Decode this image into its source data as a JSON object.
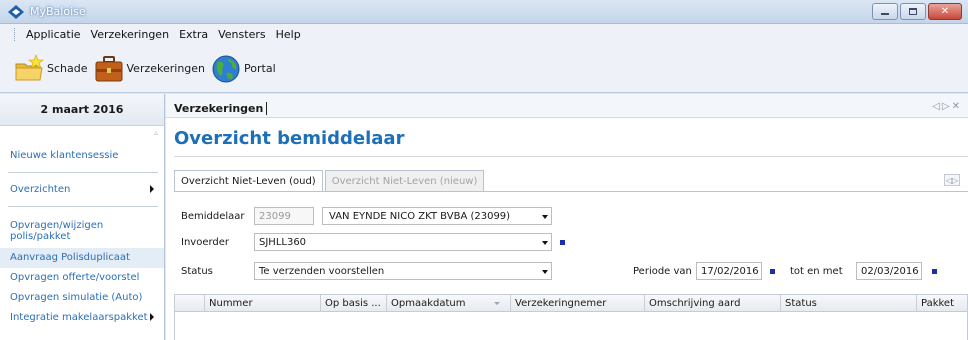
{
  "window": {
    "title": "MyBaloise"
  },
  "menu": [
    "Applicatie",
    "Verzekeringen",
    "Extra",
    "Vensters",
    "Help"
  ],
  "toolbar": [
    {
      "label": "Schade",
      "icon": "folder-star-icon"
    },
    {
      "label": "Verzekeringen",
      "icon": "briefcase-icon"
    },
    {
      "label": "Portal",
      "icon": "globe-icon"
    }
  ],
  "left_panel": {
    "date": "2 maart 2016",
    "items": {
      "new_session": "Nieuwe klantensessie",
      "overviews": "Overzichten",
      "query_change_1": "Opvragen/wijzigen",
      "query_change_2": "polis/pakket",
      "duplicate": "Aanvraag Polisduplicaat",
      "quote": "Opvragen offerte/voorstel",
      "simulation": "Opvragen simulatie (Auto)",
      "integration": "Integratie makelaarspakket"
    }
  },
  "main": {
    "tab": "Verzekeringen",
    "title": "Overzicht bemiddelaar",
    "subtabs": {
      "active": "Overzicht Niet-Leven (oud)",
      "inactive": "Overzicht Niet-Leven (nieuw)"
    },
    "form": {
      "bemiddelaar_label": "Bemiddelaar",
      "bemiddelaar_code": "23099",
      "bemiddelaar_name": "VAN EYNDE NICO ZKT BVBA (23099)",
      "invoerder_label": "Invoerder",
      "invoerder_value": "SJHLL360",
      "status_label": "Status",
      "status_value": "Te verzenden voorstellen",
      "periode_label": "Periode van",
      "periode_from": "17/02/2016",
      "tot_label": "tot en met",
      "periode_to": "02/03/2016"
    },
    "grid_columns": [
      "Nummer",
      "Op basis ...",
      "Opmaakdatum",
      "Verzekeringnemer",
      "Omschrijving aard",
      "Status",
      "Pakket"
    ]
  },
  "colors": {
    "accent": "#1d6fb8",
    "link": "#2a6fb6",
    "marker": "#1b2fa6"
  }
}
